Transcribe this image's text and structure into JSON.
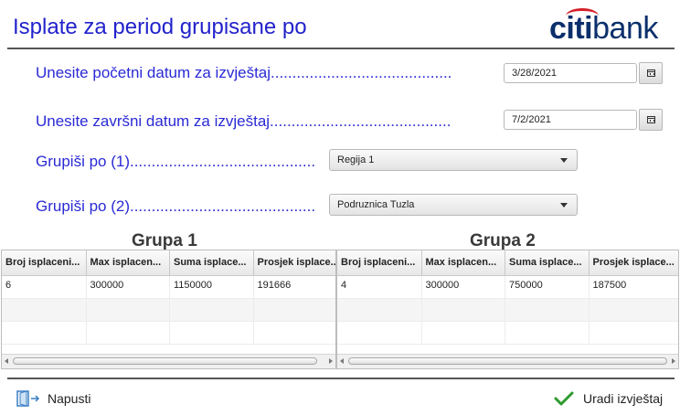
{
  "header": {
    "title": "Isplate za period grupisane po",
    "logo_citi": "citi",
    "logo_bank": "bank"
  },
  "form": {
    "start_label": "Unesite početni datum za izvještaj..........................................",
    "start_value": "3/28/2021",
    "end_label": "Unesite završni datum za izvještaj..........................................",
    "end_value": "7/2/2021",
    "group1_label": "Grupiši po (1)...........................................",
    "group1_value": "Regija 1",
    "group2_label": "Grupiši po (2)...........................................",
    "group2_value": "Podruznica Tuzla"
  },
  "group1": {
    "title": "Grupa 1",
    "columns": [
      "Broj isplaceni...",
      "Max isplacen...",
      "Suma isplace...",
      "Prosjek isplace..."
    ],
    "rows": [
      [
        "6",
        "300000",
        "1150000",
        "191666"
      ]
    ]
  },
  "group2": {
    "title": "Grupa 2",
    "columns": [
      "Broj isplaceni...",
      "Max isplacen...",
      "Suma isplace...",
      "Prosjek isplace..."
    ],
    "rows": [
      [
        "4",
        "300000",
        "750000",
        "187500"
      ]
    ]
  },
  "footer": {
    "exit_label": "Napusti",
    "run_label": "Uradi izvještaj"
  },
  "colors": {
    "label_blue": "#2a2ad6",
    "title_blue": "#2222cc",
    "check_green": "#2e9a2e",
    "logo_navy": "#0b2f6b",
    "logo_red": "#d6202a"
  },
  "icons": {
    "exit": "exit-door-icon",
    "run": "checkmark-icon",
    "calendar": "calendar-icon",
    "dropdown": "chevron-down-icon"
  }
}
